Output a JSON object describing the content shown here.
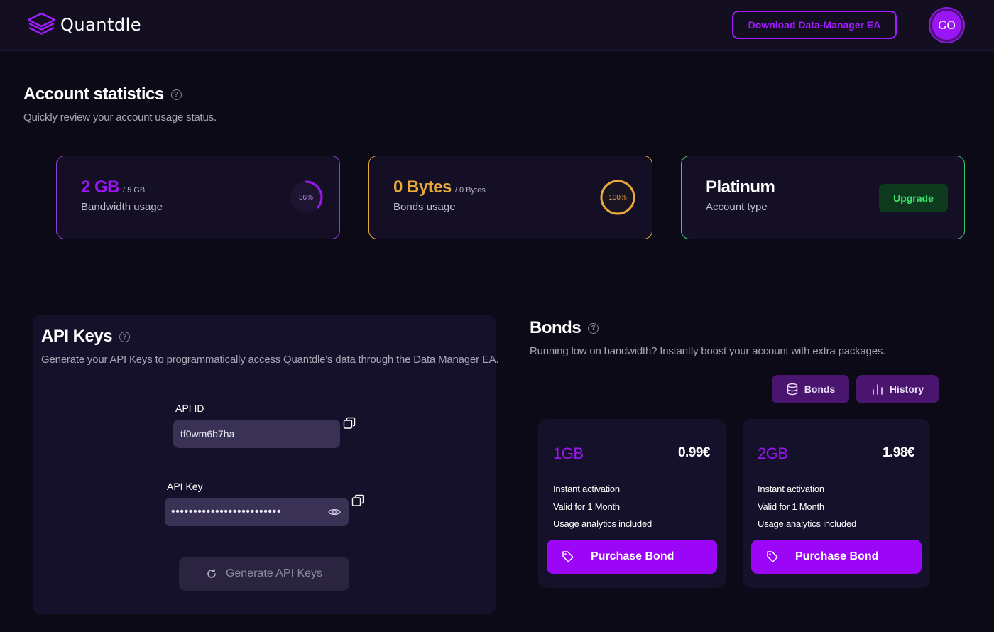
{
  "header": {
    "logo_text": "Quantdle",
    "download_label": "Download Data-Manager EA",
    "avatar_initials": "GO"
  },
  "stats": {
    "title": "Account statistics",
    "subtitle": "Quickly review your account usage status.",
    "bandwidth": {
      "value": "2 GB",
      "total": "/ 5 GB",
      "label": "Bandwidth usage",
      "percent_text": "36%",
      "percent": 36,
      "color": "#9b16f5"
    },
    "bonds": {
      "value": "0 Bytes",
      "total": "/ 0 Bytes",
      "label": "Bonds usage",
      "percent_text": "100%",
      "percent": 100,
      "color": "#e7a93a"
    },
    "account": {
      "value": "Platinum",
      "label": "Account type",
      "upgrade_label": "Upgrade"
    }
  },
  "api": {
    "title": "API Keys",
    "subtitle": "Generate your API Keys to programmatically access Quantdle's data through the Data Manager EA.",
    "id_label": "API ID",
    "id_value": "tf0wm6b7ha",
    "key_label": "API Key",
    "key_value": "•••••••••••••••••••••••••",
    "generate_label": "Generate API Keys"
  },
  "bonds": {
    "title": "Bonds",
    "subtitle": "Running low on bandwidth? Instantly boost your account with extra packages.",
    "tabs": [
      {
        "label": "Bonds",
        "icon": "database-icon"
      },
      {
        "label": "History",
        "icon": "chart-bars-icon"
      }
    ],
    "packages": [
      {
        "size": "1GB",
        "price": "0.99€",
        "features": [
          "Instant activation",
          "Valid for 1 Month",
          "Usage analytics included"
        ],
        "button": "Purchase Bond"
      },
      {
        "size": "2GB",
        "price": "1.98€",
        "features": [
          "Instant activation",
          "Valid for 1 Month",
          "Usage analytics included"
        ],
        "button": "Purchase Bond"
      }
    ]
  }
}
